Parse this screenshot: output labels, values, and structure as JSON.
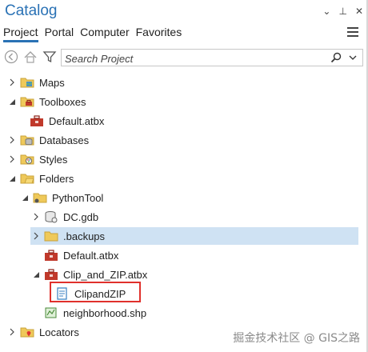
{
  "window": {
    "title": "Catalog",
    "dropdown_glyph": "⌄",
    "pin_glyph": "⊥",
    "close_glyph": "✕"
  },
  "tabs": [
    {
      "label": "Project",
      "active": true
    },
    {
      "label": "Portal"
    },
    {
      "label": "Computer"
    },
    {
      "label": "Favorites"
    }
  ],
  "toolbar": {
    "search_placeholder": "Search Project"
  },
  "tree": [
    {
      "label": "Maps",
      "icon": "maps-folder-icon"
    },
    {
      "label": "Toolboxes",
      "icon": "toolboxes-folder-icon"
    },
    {
      "label": "Default.atbx",
      "icon": "toolbox-icon"
    },
    {
      "label": "Databases",
      "icon": "databases-folder-icon"
    },
    {
      "label": "Styles",
      "icon": "styles-folder-icon"
    },
    {
      "label": "Folders",
      "icon": "folders-folder-icon"
    },
    {
      "label": "PythonTool",
      "icon": "folder-icon"
    },
    {
      "label": "DC.gdb",
      "icon": "geodatabase-icon"
    },
    {
      "label": ".backups",
      "icon": "folder-icon",
      "selected": true
    },
    {
      "label": "Default.atbx",
      "icon": "toolbox-icon"
    },
    {
      "label": "Clip_and_ZIP.atbx",
      "icon": "toolbox-icon"
    },
    {
      "label": "ClipandZIP",
      "icon": "script-tool-icon"
    },
    {
      "label": "neighborhood.shp",
      "icon": "shapefile-icon"
    },
    {
      "label": "Locators",
      "icon": "locators-folder-icon"
    }
  ],
  "watermark": "掘金技术社区 @ GIS之路",
  "colors": {
    "accent": "#2a72b5",
    "selection": "#cfe2f3",
    "highlight": "#e0302c"
  }
}
